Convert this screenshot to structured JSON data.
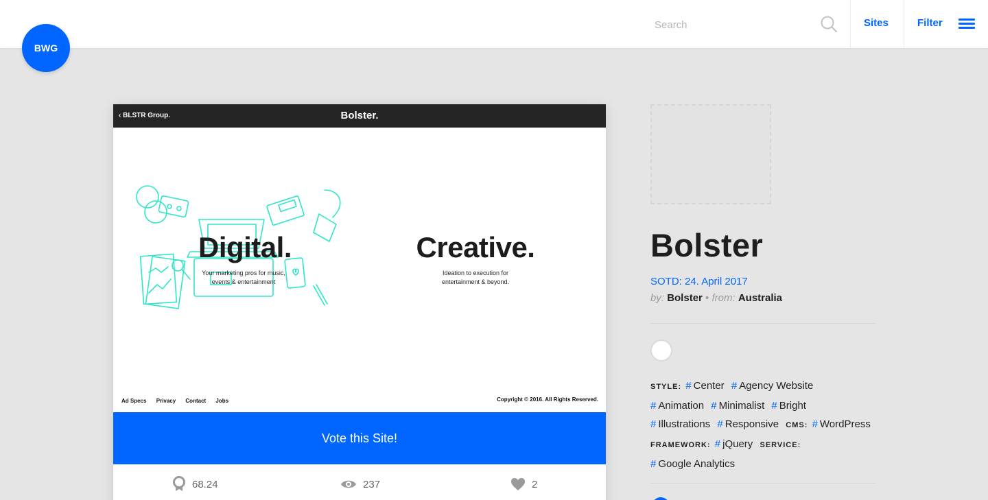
{
  "header": {
    "logo_text": "BWG",
    "search_placeholder": "Search",
    "nav": {
      "sites": "Sites",
      "filter": "Filter"
    },
    "accent_color": "#0066ff"
  },
  "preview": {
    "back_link": "‹ BLSTR Group.",
    "brand": "Bolster.",
    "heading_left": "Digital.",
    "subtext_left_1": "Your marketing pros for music,",
    "subtext_left_2": "events & entertainment",
    "heading_right": "Creative.",
    "subtext_right_1": "Ideation to execution for",
    "subtext_right_2": "entertainment & beyond.",
    "footer_links": [
      "Ad Specs",
      "Privacy",
      "Contact",
      "Jobs"
    ],
    "copyright": "Copyright © 2016. All Rights Reserved."
  },
  "vote": {
    "label": "Vote this Site!"
  },
  "stats": {
    "score": "68.24",
    "views": "237",
    "likes": "2"
  },
  "site": {
    "title": "Bolster",
    "sotd": "SOTD: 24. April 2017",
    "by_label": "by:",
    "by_value": "Bolster",
    "separator": "•",
    "from_label": "from:",
    "from_value": "Australia",
    "swatch_color": "#ffffff"
  },
  "tags": {
    "style_label": "STYLE:",
    "style": [
      "Center",
      "Agency Website",
      "Animation",
      "Minimalist",
      "Bright",
      "Illustrations",
      "Responsive"
    ],
    "cms_label": "CMS:",
    "cms": [
      "WordPress"
    ],
    "framework_label": "FRAMEWORK:",
    "framework": [
      "jQuery"
    ],
    "service_label": "SERVICE:",
    "service": [
      "Google Analytics"
    ]
  }
}
